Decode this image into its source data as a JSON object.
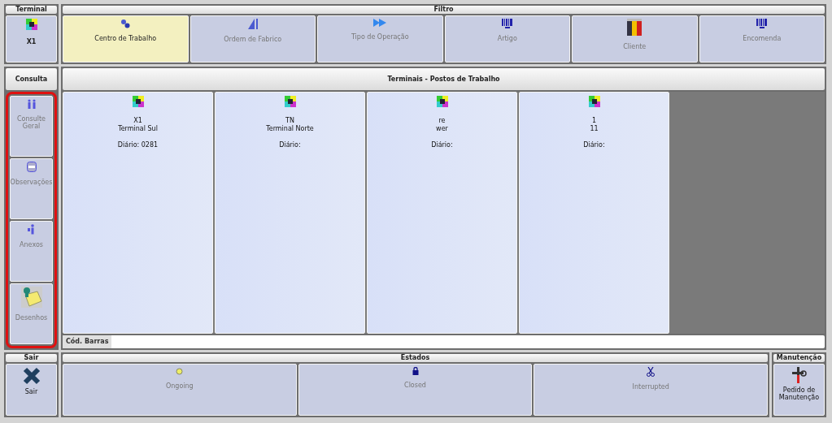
{
  "terminal": {
    "title": "Terminal",
    "button": "X1"
  },
  "filtro": {
    "title": "Filtro",
    "items": [
      {
        "label": "Centro de Trabalho",
        "selected": true,
        "disabled": false
      },
      {
        "label": "Ordem de Fabrico",
        "selected": false,
        "disabled": true
      },
      {
        "label": "Tipo de Operação",
        "selected": false,
        "disabled": true
      },
      {
        "label": "Artigo",
        "selected": false,
        "disabled": true
      },
      {
        "label": "Cliente",
        "selected": false,
        "disabled": true
      },
      {
        "label": "Encomenda",
        "selected": false,
        "disabled": true
      }
    ]
  },
  "consulta": {
    "title": "Consulta",
    "highlighted": true,
    "items": [
      {
        "label": "Consulte Geral",
        "disabled": true
      },
      {
        "label": "Observações",
        "disabled": true
      },
      {
        "label": "Anexos",
        "disabled": true
      },
      {
        "label": "Desenhos",
        "disabled": true
      }
    ]
  },
  "terminais": {
    "title": "Terminais - Postos de Trabalho",
    "cards": [
      {
        "code": "X1",
        "name": "Terminal Sul",
        "diario": "Diário: 0281"
      },
      {
        "code": "TN",
        "name": "Terminal Norte",
        "diario": "Diário:"
      },
      {
        "code": "re",
        "name": "wer",
        "diario": "Diário:"
      },
      {
        "code": "1",
        "name": "11",
        "diario": "Diário:"
      }
    ]
  },
  "barcode": {
    "label": "Cód. Barras"
  },
  "sair": {
    "title": "Sair",
    "button": "Sair"
  },
  "estados": {
    "title": "Estados",
    "items": [
      {
        "label": "Ongoing",
        "disabled": true
      },
      {
        "label": "Closed",
        "disabled": true
      },
      {
        "label": "Interrupted",
        "disabled": true
      }
    ]
  },
  "manutencao": {
    "title": "Manutenção",
    "button": "Pedido de Manutenção"
  }
}
